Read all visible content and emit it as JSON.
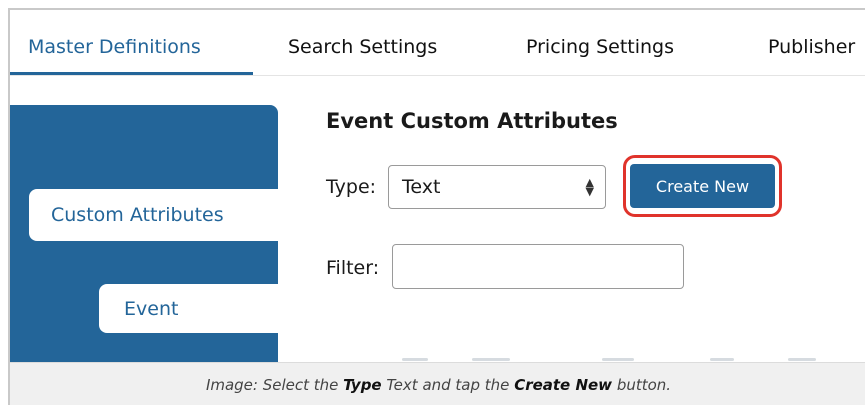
{
  "tabs": [
    {
      "label": "Master Definitions"
    },
    {
      "label": "Search Settings"
    },
    {
      "label": "Pricing Settings"
    },
    {
      "label": "Publisher"
    }
  ],
  "sidebar": {
    "items": [
      {
        "label": "Custom Attributes"
      },
      {
        "label": "Event"
      }
    ]
  },
  "main": {
    "heading": "Event Custom Attributes",
    "type_label": "Type:",
    "type_value": "Text",
    "create_button": "Create New",
    "filter_label": "Filter:",
    "filter_value": ""
  },
  "caption": {
    "prefix": "Image: Select the ",
    "type_word": "Type",
    "middle": " Text and tap the ",
    "create_word": "Create New",
    "suffix": " button."
  },
  "colors": {
    "brand": "#236599",
    "highlight": "#e0332b"
  }
}
